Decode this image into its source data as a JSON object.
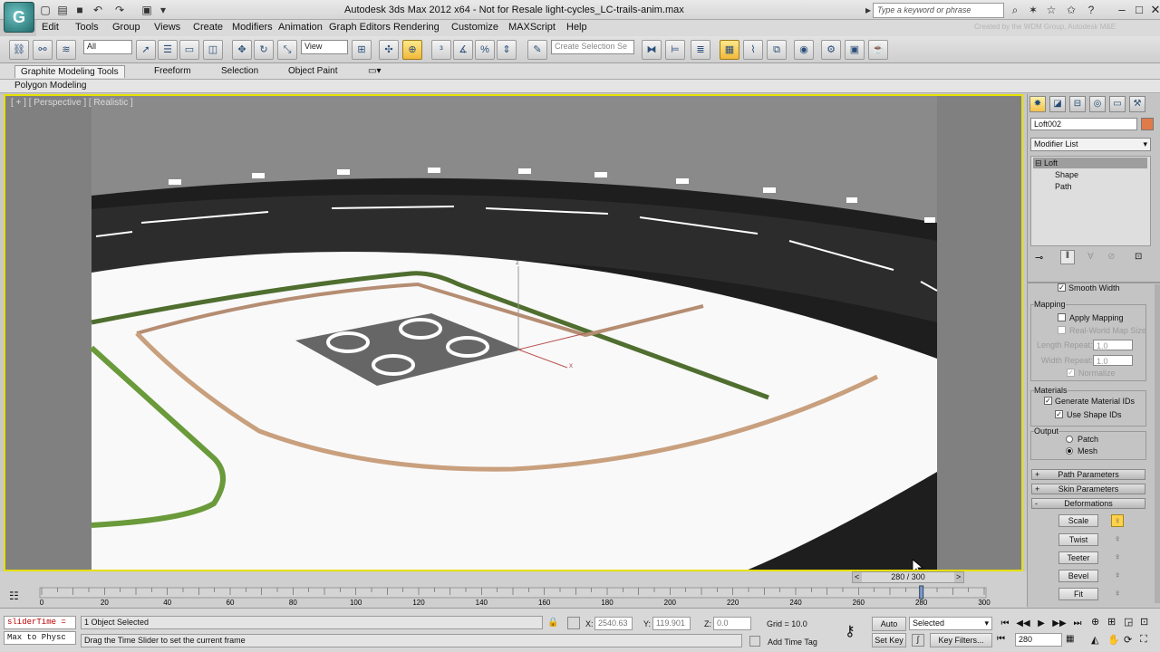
{
  "window": {
    "title": "Autodesk 3ds Max  2012 x64  -  Not for Resale    light-cycles_LC-trails-anim.max",
    "search_placeholder": "Type a keyword or phrase",
    "credit": "Created by the WDM Group, Autodesk M&E",
    "logo": "3ds-max-logo"
  },
  "menu": [
    "Edit",
    "Tools",
    "Group",
    "Views",
    "Create",
    "Modifiers",
    "Animation",
    "Graph Editors",
    "Rendering",
    "Customize",
    "MAXScript",
    "Help"
  ],
  "toolbar": {
    "selection_filter": "All",
    "ref_coord": "View",
    "named_selection_placeholder": "Create Selection Se"
  },
  "ribbon": {
    "tabs": [
      "Graphite Modeling Tools",
      "Freeform",
      "Selection",
      "Object Paint"
    ],
    "panel_label": "Polygon Modeling"
  },
  "viewport": {
    "label": "[ + ] [ Perspective ] [ Realistic ]",
    "axis_z": "z",
    "axis_x": "x"
  },
  "command_panel": {
    "object_name": "Loft002",
    "object_color": "#e07a4a",
    "modifier_list": "Modifier List",
    "stack": [
      "Loft",
      "Shape",
      "Path"
    ],
    "smooth_width": "Smooth Width",
    "mapping_title": "Mapping",
    "apply_mapping": "Apply Mapping",
    "real_world": "Real-World Map Size",
    "length_repeat_label": "Length Repeat:",
    "length_repeat_value": "1.0",
    "width_repeat_label": "Width Repeat:",
    "width_repeat_value": "1.0",
    "normalize": "Normalize",
    "materials_title": "Materials",
    "gen_mat_ids": "Generate Material IDs",
    "use_shape_ids": "Use Shape IDs",
    "output_title": "Output",
    "patch": "Patch",
    "mesh": "Mesh",
    "rollouts": [
      "Path Parameters",
      "Skin Parameters",
      "Deformations"
    ],
    "deformations": [
      "Scale",
      "Twist",
      "Teeter",
      "Bevel",
      "Fit"
    ]
  },
  "timeline": {
    "frame_label": "280 / 300",
    "current_frame": 280,
    "total_frames": 300,
    "ticks": [
      "0",
      "20",
      "40",
      "60",
      "80",
      "100",
      "120",
      "140",
      "160",
      "180",
      "200",
      "220",
      "240",
      "260",
      "280",
      "300"
    ]
  },
  "status": {
    "maxscript_line1": "sliderTime =",
    "maxscript_line2": "Max to Physc",
    "selection_info": "1 Object Selected",
    "prompt": "Drag the Time Slider to set the current frame",
    "x_label": "X:",
    "x_value": "2540.63",
    "y_label": "Y:",
    "y_value": "119.901",
    "z_label": "Z:",
    "z_value": "0.0",
    "grid": "Grid = 10.0",
    "add_time_tag": "Add Time Tag",
    "auto_key": "Auto Key",
    "set_key": "Set Key",
    "key_mode": "Selected",
    "key_filters": "Key Filters...",
    "frame_field": "280"
  }
}
